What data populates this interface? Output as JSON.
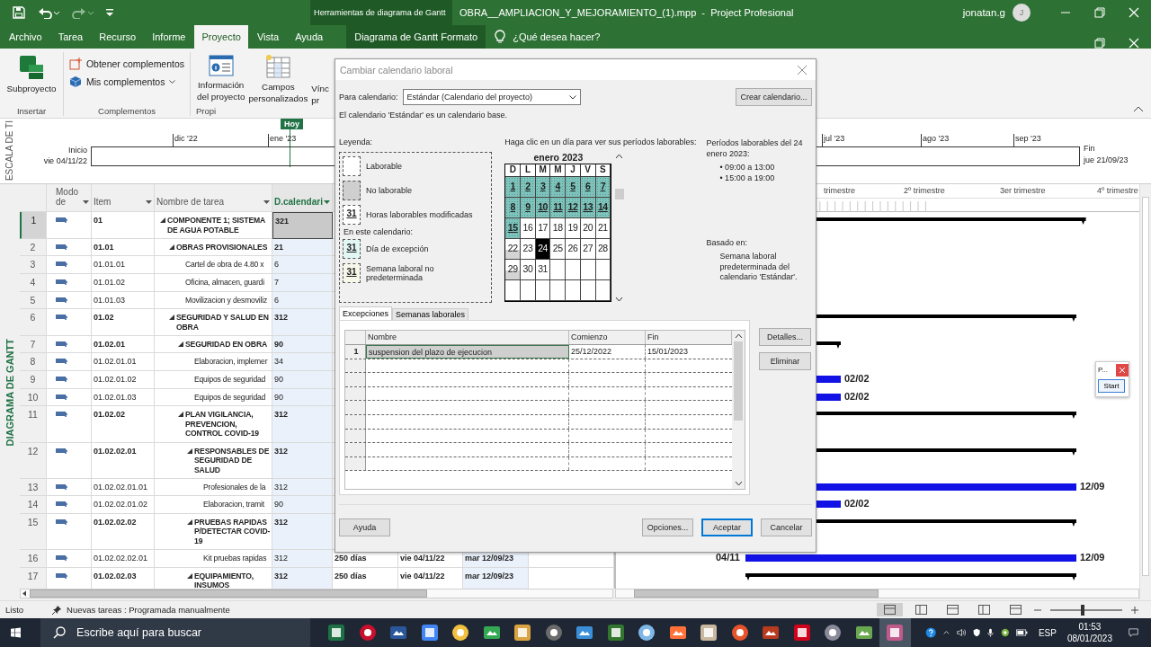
{
  "title_bar": {
    "contextual_label": "Herramientas de diagrama de Gantt",
    "title": "OBRA__AMPLIACION_Y_MEJORAMIENTO_(1).mpp  -  Project Profesional",
    "user": "jonatan.g",
    "avatar_initial": "J"
  },
  "ribbon_tabs": [
    {
      "label": "Archivo",
      "selected": false,
      "kind": "normal"
    },
    {
      "label": "Tarea",
      "selected": false,
      "kind": "normal"
    },
    {
      "label": "Recurso",
      "selected": false,
      "kind": "normal"
    },
    {
      "label": "Informe",
      "selected": false,
      "kind": "normal"
    },
    {
      "label": "Proyecto",
      "selected": true,
      "kind": "normal"
    },
    {
      "label": "Vista",
      "selected": false,
      "kind": "normal"
    },
    {
      "label": "Ayuda",
      "selected": false,
      "kind": "normal"
    },
    {
      "label": "Diagrama de Gantt Formato",
      "selected": false,
      "kind": "contextual"
    }
  ],
  "tell_me": "¿Qué desea hacer?",
  "ribbon_groups": [
    {
      "label": "Insertar",
      "commands": [
        {
          "kind": "large",
          "lines": [
            "Subproyecto"
          ]
        }
      ]
    },
    {
      "label": "Complementos",
      "commands": [
        {
          "kind": "small",
          "lines": [
            "Obtener complementos"
          ]
        },
        {
          "kind": "small_dropdown",
          "lines": [
            "Mis complementos"
          ]
        }
      ]
    },
    {
      "label": "Propi",
      "commands": [
        {
          "kind": "large",
          "lines": [
            "Información",
            "del proyecto"
          ]
        },
        {
          "kind": "large",
          "lines": [
            "Campos",
            "personalizados"
          ]
        },
        {
          "kind": "cut",
          "lines": [
            "Vínc",
            "pr"
          ]
        }
      ]
    }
  ],
  "timeline": {
    "side_label": "ESCALA DE TI",
    "today": "Hoy",
    "start_label": "Inicio",
    "start_date": "vie 04/11/22",
    "months": [
      "dic '22",
      "ene '23",
      "jul '23",
      "ago '23",
      "sep '23"
    ],
    "finish_label": "Fin",
    "finish_date": "jue 21/09/23"
  },
  "table": {
    "side_label": "DIAGRAMA DE GANTT",
    "columns": [
      {
        "lines": [
          "Modo",
          "de"
        ],
        "selected": false
      },
      {
        "lines": [
          "Item"
        ],
        "selected": false
      },
      {
        "lines": [
          "Nombre de tarea"
        ],
        "selected": false
      },
      {
        "lines": [
          "D.calendari"
        ],
        "selected": true
      }
    ],
    "rows": [
      {
        "id": "1",
        "item": "01",
        "name": "COMPONENTE 1; SISTEMA DE AGUA POTABLE",
        "duration": "321",
        "kind": "summary",
        "expanded": true,
        "selected": true,
        "bar": {
          "kind": "summary"
        },
        "children": [
          {
            "id": "2",
            "item": "01.01",
            "name": "OBRAS PROVISIONALES",
            "duration": "21",
            "kind": "summary",
            "expanded": true,
            "selected": false,
            "children": [
              {
                "id": "3",
                "item": "01.01.01",
                "name": "Cartel de obra de 4.80 x",
                "duration": "6",
                "kind": "task",
                "selected": false
              },
              {
                "id": "4",
                "item": "01.01.02",
                "name": "Oficina, almacen, guardi",
                "duration": "7",
                "kind": "task",
                "selected": false
              },
              {
                "id": "5",
                "item": "01.01.03",
                "name": "Movilizacion y desmoviliz",
                "duration": "6",
                "kind": "task",
                "selected": false
              }
            ]
          },
          {
            "id": "6",
            "item": "01.02",
            "name": "SEGURIDAD Y SALUD EN OBRA",
            "duration": "312",
            "kind": "summary",
            "expanded": true,
            "selected": false,
            "bar": {
              "kind": "summary"
            },
            "children": [
              {
                "id": "7",
                "item": "01.02.01",
                "name": "SEGURIDAD EN OBRA",
                "duration": "90",
                "kind": "summary",
                "expanded": true,
                "selected": false,
                "bar": {
                  "kind": "summary"
                },
                "children": [
                  {
                    "id": "8",
                    "item": "01.02.01.01",
                    "name": "Elaboracion, implemer",
                    "duration": "34",
                    "kind": "task",
                    "selected": false
                  },
                  {
                    "id": "9",
                    "item": "01.02.01.02",
                    "name": "Equipos de seguridad",
                    "duration": "90",
                    "kind": "task",
                    "selected": false,
                    "bar": {
                      "kind": "task",
                      "finish_label": "02/02"
                    }
                  },
                  {
                    "id": "10",
                    "item": "01.02.01.03",
                    "name": "Equipos de seguridad",
                    "duration": "90",
                    "kind": "task",
                    "selected": false,
                    "bar": {
                      "kind": "task",
                      "finish_label": "02/02"
                    }
                  }
                ]
              },
              {
                "id": "11",
                "item": "01.02.02",
                "name": "PLAN VIGILANCIA, PREVENCION, CONTROL COVID-19",
                "duration": "312",
                "kind": "summary",
                "expanded": true,
                "selected": false,
                "bar": {
                  "kind": "summary"
                },
                "children": [
                  {
                    "id": "12",
                    "item": "01.02.02.01",
                    "name": "RESPONSABLES DE SEGURIDAD DE SALUD",
                    "duration": "312",
                    "kind": "summary",
                    "expanded": true,
                    "selected": false,
                    "bar": {
                      "kind": "summary"
                    },
                    "children": [
                      {
                        "id": "13",
                        "item": "01.02.02.01.01",
                        "name": "Profesionales de la",
                        "duration": "312",
                        "kind": "task",
                        "selected": false,
                        "bar": {
                          "kind": "task",
                          "finish_label": "12/09"
                        }
                      },
                      {
                        "id": "14",
                        "item": "01.02.02.01.02",
                        "name": "Elaboracion, tramit",
                        "duration": "90",
                        "kind": "task",
                        "selected": false,
                        "bar": {
                          "kind": "task",
                          "finish_label": "02/02"
                        }
                      }
                    ]
                  },
                  {
                    "id": "15",
                    "item": "01.02.02.02",
                    "name": "PRUEBAS RAPIDAS P/DETECTAR COVID-19",
                    "duration": "312",
                    "kind": "summary",
                    "expanded": true,
                    "selected": false,
                    "bar": {
                      "kind": "summary"
                    },
                    "children": [
                      {
                        "id": "16",
                        "item": "01.02.02.02.01",
                        "name": "Kit pruebas rapidas",
                        "duration": "312",
                        "kind": "task",
                        "selected": false,
                        "column_5": "250 días",
                        "column_6": "vie 04/11/22",
                        "column_7": "mar 12/09/23",
                        "bar": {
                          "kind": "task",
                          "start_label": "04/11",
                          "finish_label": "12/09"
                        }
                      }
                    ]
                  },
                  {
                    "id": "17",
                    "item": "01.02.02.03",
                    "name": "EQUIPAMIENTO, INSUMOS",
                    "duration": "312",
                    "kind": "summary",
                    "expanded": true,
                    "selected": false,
                    "column_5": "250 días",
                    "column_6": "vie 04/11/22",
                    "column_7": "mar 12/09/23",
                    "bar": {
                      "kind": "summary"
                    }
                  }
                ]
              }
            ]
          }
        ]
      }
    ]
  },
  "gantt": {
    "top_tier": [
      "trimestre",
      "2º trimestre",
      "3er trimestre",
      "4º trimestre"
    ]
  },
  "floating_window": {
    "title": "P...",
    "button": "Start"
  },
  "dialog": {
    "title": "Cambiar calendario laboral",
    "for_label": "Para calendario:",
    "calendar_value": "Estándar (Calendario del proyecto)",
    "create_button": "Crear calendario...",
    "note": "El calendario 'Estándar' es un calendario base.",
    "legend": {
      "title": "Leyenda:",
      "items": [
        {
          "kind": "working",
          "label": "Laborable"
        },
        {
          "kind": "nonworking",
          "label": "No laborable"
        },
        {
          "kind": "modified",
          "swatch_text": "31",
          "label": "Horas laborables modificadas"
        }
      ],
      "subheading": "En este calendario:",
      "calendar_items": [
        {
          "kind": "exception",
          "swatch_text": "31",
          "label": "Día de excepción"
        },
        {
          "kind": "nondefault",
          "swatch_text": "31",
          "label": "Semana laboral no predeterminada"
        }
      ]
    },
    "calendar": {
      "hint": "Haga clic en un día para ver sus períodos laborables:",
      "month": "enero 2023",
      "weekdays": [
        "D",
        "L",
        "M",
        "M",
        "J",
        "V",
        "S"
      ],
      "days": [
        {
          "day": "1",
          "kind": "exception",
          "selected": false
        },
        {
          "day": "2",
          "kind": "exception",
          "selected": false
        },
        {
          "day": "3",
          "kind": "exception",
          "selected": false
        },
        {
          "day": "4",
          "kind": "exception",
          "selected": false
        },
        {
          "day": "5",
          "kind": "exception",
          "selected": false
        },
        {
          "day": "6",
          "kind": "exception",
          "selected": false
        },
        {
          "day": "7",
          "kind": "exception",
          "selected": false
        },
        {
          "day": "8",
          "kind": "exception",
          "selected": false
        },
        {
          "day": "9",
          "kind": "exception",
          "selected": false
        },
        {
          "day": "10",
          "kind": "exception",
          "selected": false
        },
        {
          "day": "11",
          "kind": "exception",
          "selected": false
        },
        {
          "day": "12",
          "kind": "exception",
          "selected": false
        },
        {
          "day": "13",
          "kind": "exception",
          "selected": false
        },
        {
          "day": "14",
          "kind": "exception",
          "selected": false
        },
        {
          "day": "15",
          "kind": "exception",
          "selected": false
        },
        {
          "day": "16",
          "kind": "working",
          "selected": false
        },
        {
          "day": "17",
          "kind": "working",
          "selected": false
        },
        {
          "day": "18",
          "kind": "working",
          "selected": false
        },
        {
          "day": "19",
          "kind": "working",
          "selected": false
        },
        {
          "day": "20",
          "kind": "working",
          "selected": false
        },
        {
          "day": "21",
          "kind": "working",
          "selected": false
        },
        {
          "day": "22",
          "kind": "nonworking",
          "selected": false
        },
        {
          "day": "23",
          "kind": "working",
          "selected": false
        },
        {
          "day": "24",
          "kind": "working",
          "selected": true
        },
        {
          "day": "25",
          "kind": "working",
          "selected": false
        },
        {
          "day": "26",
          "kind": "working",
          "selected": false
        },
        {
          "day": "27",
          "kind": "working",
          "selected": false
        },
        {
          "day": "28",
          "kind": "working",
          "selected": false
        },
        {
          "day": "29",
          "kind": "nonworking",
          "selected": false
        },
        {
          "day": "30",
          "kind": "working",
          "selected": false
        },
        {
          "day": "31",
          "kind": "working",
          "selected": false
        }
      ]
    },
    "periods": {
      "title": "Períodos laborables del 24 enero 2023:",
      "items": [
        "• 09:00 a 13:00",
        "• 15:00 a 19:00"
      ],
      "based_label": "Basado en:",
      "based_text": "Semana laboral predeterminada del calendario 'Estándar'."
    },
    "tabs": [
      {
        "label": "Excepciones",
        "selected": true
      },
      {
        "label": "Semanas laborales",
        "selected": false
      }
    ],
    "exceptions": {
      "columns": [
        "Nombre",
        "Comienzo",
        "Fin"
      ],
      "rows": [
        {
          "number": "1",
          "name": "suspension del plazo de ejecucion",
          "start": "25/12/2022",
          "finish": "15/01/2023",
          "selected": true
        }
      ]
    },
    "side_buttons": [
      "Detalles...",
      "Eliminar"
    ],
    "help_button": "Ayuda",
    "buttons": [
      {
        "label": "Opciones...",
        "default": false
      },
      {
        "label": "Aceptar",
        "default": true
      },
      {
        "label": "Cancelar",
        "default": false
      }
    ]
  },
  "status_bar": {
    "ready": "Listo",
    "new_tasks": "Nuevas tareas : Programada manualmente",
    "zoom": {
      "level": 0.42
    }
  },
  "taskbar": {
    "search_placeholder": "Escribe aquí para buscar",
    "apps": [
      {
        "color": "#1e7145",
        "selected": false
      },
      {
        "color": "#c8102e",
        "selected": false
      },
      {
        "color": "#2b579a",
        "selected": false
      },
      {
        "color": "#4285f4",
        "selected": false
      },
      {
        "color": "#f0c040",
        "selected": false
      },
      {
        "color": "#34a853",
        "selected": false
      },
      {
        "color": "#d9a441",
        "selected": false
      },
      {
        "color": "#6b6b6b",
        "selected": false
      },
      {
        "color": "#3a8fd8",
        "selected": false
      },
      {
        "color": "#31752f",
        "selected": false
      },
      {
        "color": "#7fb8e8",
        "selected": false
      },
      {
        "color": "#ff7139",
        "selected": false
      },
      {
        "color": "#c9b8a0",
        "selected": false
      },
      {
        "color": "#e5532d",
        "selected": false
      },
      {
        "color": "#b83a1f",
        "selected": false
      },
      {
        "color": "#d0021b",
        "selected": false
      },
      {
        "color": "#8a8a9a",
        "selected": false
      },
      {
        "color": "#6aa84f",
        "selected": false
      },
      {
        "color": "#c05a8a",
        "selected": true
      }
    ],
    "language": "ESP",
    "time": "01:53",
    "date": "08/01/2023"
  }
}
